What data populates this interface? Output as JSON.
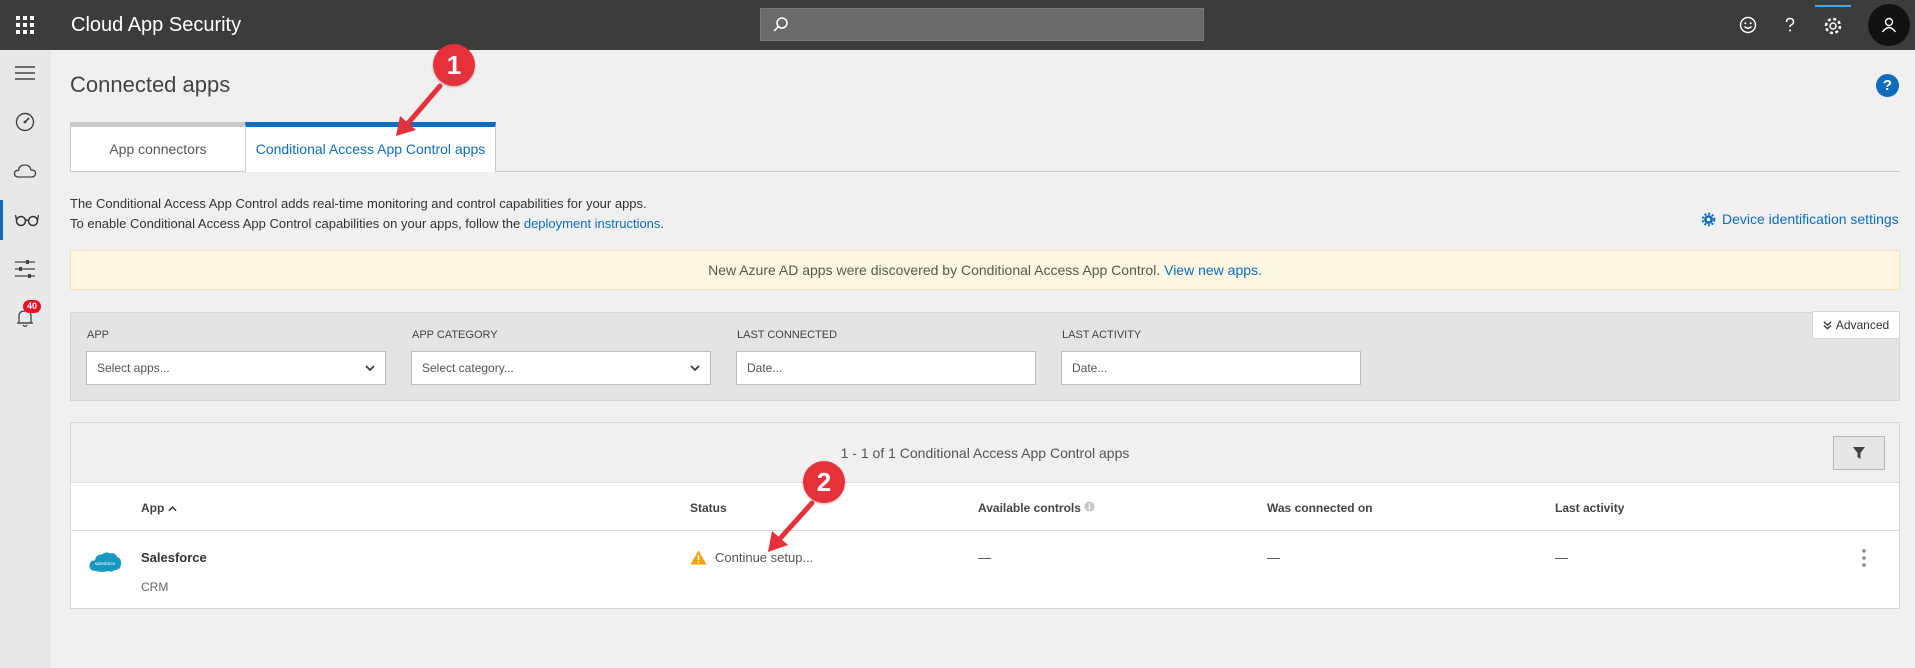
{
  "app": {
    "title": "Cloud App Security"
  },
  "search": {
    "placeholder": ""
  },
  "rail": {
    "alerts_badge": "40"
  },
  "page": {
    "title": "Connected apps"
  },
  "tabs": [
    {
      "label": "App connectors",
      "active": false
    },
    {
      "label": "Conditional Access App Control apps",
      "active": true
    }
  ],
  "description": {
    "line1": "The Conditional Access App Control adds real-time monitoring and control capabilities for your apps.",
    "line2_prefix": "To enable Conditional Access App Control capabilities on your apps, follow the ",
    "line2_link": "deployment instructions",
    "line2_suffix": "."
  },
  "device_settings": {
    "label": "Device identification settings"
  },
  "notice": {
    "text": "New Azure AD apps were discovered by Conditional Access App Control. ",
    "link": "View new apps."
  },
  "filters": {
    "advanced_label": "Advanced",
    "items": [
      {
        "label": "APP",
        "value": "Select apps...",
        "type": "select"
      },
      {
        "label": "APP CATEGORY",
        "value": "Select category...",
        "type": "select"
      },
      {
        "label": "LAST CONNECTED",
        "value": "Date...",
        "type": "date"
      },
      {
        "label": "LAST ACTIVITY",
        "value": "Date...",
        "type": "date"
      }
    ]
  },
  "table": {
    "count_text": "1 - 1 of 1 Conditional Access App Control apps",
    "columns": [
      "App",
      "Status",
      "Available controls",
      "Was connected on",
      "Last activity"
    ],
    "rows": [
      {
        "app_name": "Salesforce",
        "app_category": "CRM",
        "logo_text": "salesforce",
        "status": "Continue setup...",
        "available_controls": "—",
        "was_connected_on": "—",
        "last_activity": "—"
      }
    ]
  },
  "annotations": {
    "marker1": "1",
    "marker2": "2"
  },
  "colors": {
    "accent": "#0f6cbd",
    "topbar": "#3c3c3b",
    "marker": "#e6313a",
    "warning": "#f2a20c",
    "salesforce": "#1798c1"
  }
}
